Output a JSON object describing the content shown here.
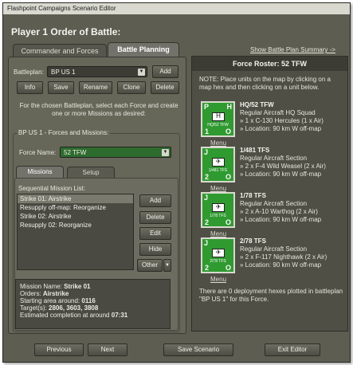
{
  "window": {
    "title": "Flashpoint Campaigns Scenario Editor"
  },
  "page": {
    "heading": "Player 1 Order of Battle:"
  },
  "tabs": [
    {
      "label": "Commander and Forces",
      "active": false
    },
    {
      "label": "Battle Planning",
      "active": true
    }
  ],
  "battleplan": {
    "label": "Battleplan:",
    "value": "BP US 1",
    "add_label": "Add",
    "buttons": [
      "Info",
      "Save",
      "Rename",
      "Clone",
      "Delete"
    ]
  },
  "instructions": "For the chosen Battleplan, select each Force and create one or more Missions as desired:",
  "forces_panel": {
    "title": "BP US 1 - Forces and Missions:",
    "force_label": "Force Name:",
    "force_value": "52 TFW",
    "subtabs": [
      {
        "label": "Missions",
        "active": true
      },
      {
        "label": "Setup",
        "active": false
      }
    ],
    "list_label": "Sequential Mission List:",
    "missions": [
      {
        "text": "Strike 01: Airstrike",
        "selected": true
      },
      {
        "text": "Resupply off-map: Reorganize",
        "selected": false
      },
      {
        "text": "Strike 02: Airstrike",
        "selected": false
      },
      {
        "text": "Resupply 02: Reorganize",
        "selected": false
      }
    ],
    "side_buttons": {
      "add": "Add",
      "delete": "Delete",
      "edit": "Edit",
      "hide": "Hide",
      "other": "Other"
    }
  },
  "mission_details": {
    "name_label": "Mission Name:",
    "name_value": "Strike 01",
    "orders_label": "Orders:",
    "orders_value": "Airstrike",
    "start_label": "Starting area around:",
    "start_value": "0116",
    "targets_label": "Target(s):",
    "targets_value": "2806, 3603, 3808",
    "completion_label": "Estimated completion at around",
    "completion_value": "07:31"
  },
  "summary_link": "Show Battle Plan Summary ->",
  "roster": {
    "title": "Force Roster: 52 TFW",
    "note": "NOTE: Place units on the map by clicking on a map hex and then clicking on a unit below.",
    "menu_label": "Menu",
    "units": [
      {
        "corner_tl": "P",
        "corner_tr": "H",
        "corner_bl": "1",
        "corner_br": "O",
        "icon_name": "HQ/52 TFW",
        "symbol": "H",
        "title": "HQ/52 TFW",
        "type": "Regular Aircraft HQ Squad",
        "equipment": "» 1 x C-130 Hercules (1 x Air)",
        "location": "» Location: 90 km W off-map"
      },
      {
        "corner_tl": "J",
        "corner_tr": "",
        "corner_bl": "2",
        "corner_br": "O",
        "icon_name": "1/481 TFS",
        "symbol": "✈",
        "title": "1/481 TFS",
        "type": "Regular Aircraft Section",
        "equipment": "» 2 x F-4 Wild Weasel (2 x Air)",
        "location": "» Location: 90 km W off-map"
      },
      {
        "corner_tl": "J",
        "corner_tr": "",
        "corner_bl": "2",
        "corner_br": "O",
        "icon_name": "1/78 TFS",
        "symbol": "✈",
        "title": "1/78 TFS",
        "type": "Regular Aircraft Section",
        "equipment": "» 2 x A-10 Warthog (2 x Air)",
        "location": "» Location: 90 km W off-map"
      },
      {
        "corner_tl": "J",
        "corner_tr": "",
        "corner_bl": "2",
        "corner_br": "O",
        "icon_name": "2/78 TFS",
        "symbol": "✈",
        "title": "2/78 TFS",
        "type": "Regular Aircraft Section",
        "equipment": "» 2 x F-117 Nighthawk (2 x Air)",
        "location": "» Location: 90 km W off-map"
      }
    ],
    "footer_note": "There are 0 deployment hexes plotted in battleplan \"BP US 1\" for this Force."
  },
  "footer": {
    "previous": "Previous",
    "next": "Next",
    "save": "Save Scenario",
    "exit": "Exit Editor"
  },
  "colors": {
    "window_bg": "#5d5d52",
    "unit_green": "#2f9a2f",
    "selected_row": "#7a7a6e"
  }
}
